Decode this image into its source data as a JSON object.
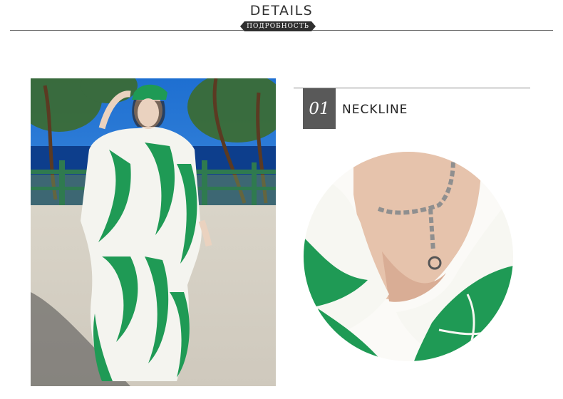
{
  "header": {
    "title": "DETAILS",
    "subtitle": "ПОДРОБНОСТЬ"
  },
  "main_image": {
    "kind": "model-in-leaf-print-kaftan-photo"
  },
  "section": {
    "number": "01",
    "title": "NECKLINE"
  },
  "detail_image": {
    "kind": "neckline-closeup-photo"
  },
  "colors": {
    "badge": "#595959",
    "leaf_green": "#1f9a55",
    "rule": "#555555"
  }
}
